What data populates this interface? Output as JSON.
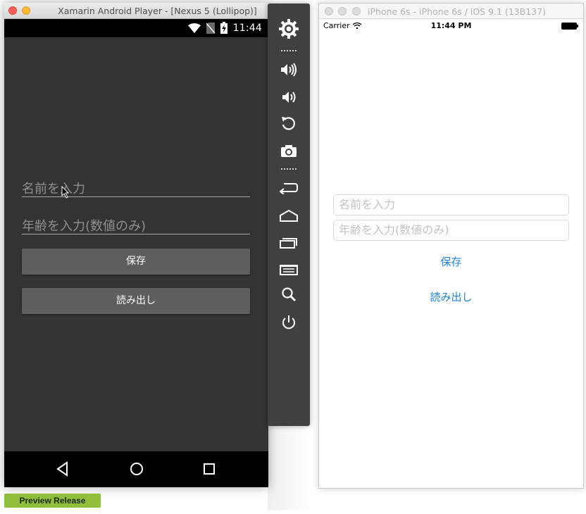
{
  "android": {
    "window_title": "Xamarin Android Player - [Nexus 5 (Lollipop)]",
    "status_time": "11:44",
    "name_placeholder": "名前を入力",
    "age_placeholder": "年齢を入力(数値のみ)",
    "save_label": "保存",
    "load_label": "読み出し",
    "badge": "Preview Release"
  },
  "toolbar": {
    "items": [
      "settings-gear",
      "volume-up",
      "volume-down",
      "rotate",
      "screenshot-camera",
      "back",
      "home",
      "recent-apps",
      "menu",
      "search",
      "power"
    ]
  },
  "ios": {
    "window_title": "iPhone 6s - iPhone 6s / iOS 9.1 (13B137)",
    "carrier": "Carrier",
    "status_time": "11:44 PM",
    "name_placeholder": "名前を入力",
    "age_placeholder": "年齢を入力(数値のみ)",
    "save_label": "保存",
    "load_label": "読み出し"
  },
  "colors": {
    "android_bg": "#333333",
    "android_button": "#5e5e5e",
    "ios_link": "#1f83db",
    "badge": "#8fbf3b"
  }
}
